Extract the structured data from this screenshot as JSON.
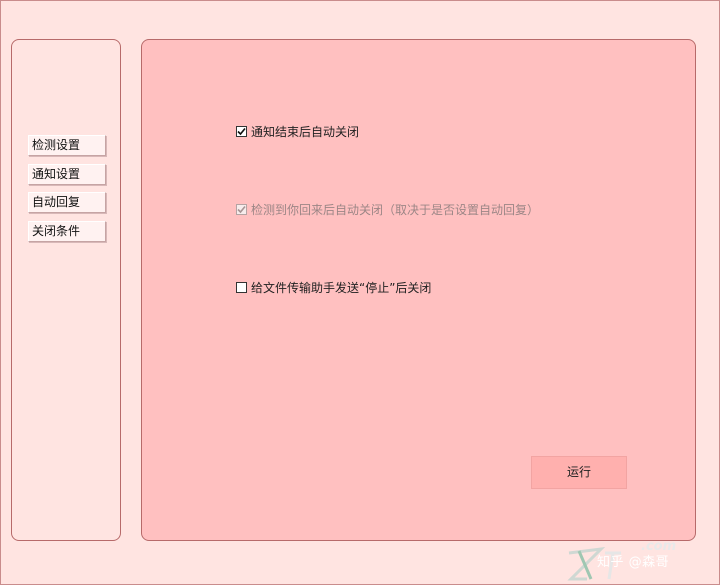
{
  "sidebar": {
    "items": [
      {
        "label": "检测设置"
      },
      {
        "label": "通知设置"
      },
      {
        "label": "自动回复"
      },
      {
        "label": "关闭条件"
      }
    ]
  },
  "main": {
    "options": [
      {
        "label": "通知结束后自动关闭",
        "checked": true,
        "enabled": true
      },
      {
        "label": "检测到你回来后自动关闭（取决于是否设置自动回复）",
        "checked": true,
        "enabled": false
      },
      {
        "label": "给文件传输助手发送“停止”后关闭",
        "checked": false,
        "enabled": true
      }
    ],
    "run_label": "运行"
  },
  "watermark": {
    "site_suffix": ".com",
    "text": "知乎 @森哥"
  },
  "colors": {
    "background": "#ffe4e1",
    "panel": "#ffc0c0",
    "border": "#b76a6a",
    "run_button": "#ffb0ae"
  }
}
